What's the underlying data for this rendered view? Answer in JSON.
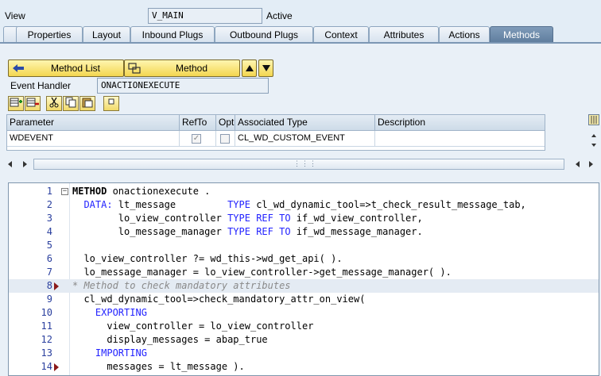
{
  "header": {
    "view_label": "View",
    "view_value": "V_MAIN",
    "status": "Active"
  },
  "tabs": [
    {
      "label": "Properties",
      "active": false
    },
    {
      "label": "Layout",
      "active": false
    },
    {
      "label": "Inbound Plugs",
      "active": false
    },
    {
      "label": "Outbound Plugs",
      "active": false
    },
    {
      "label": "Context",
      "active": false
    },
    {
      "label": "Attributes",
      "active": false
    },
    {
      "label": "Actions",
      "active": false
    },
    {
      "label": "Methods",
      "active": true
    }
  ],
  "method_toolbar": {
    "method_list_label": "Method List",
    "method_label": "Method"
  },
  "event_handler": {
    "label": "Event Handler",
    "value": "ONACTIONEXECUTE"
  },
  "param_table": {
    "columns": [
      "Parameter",
      "RefTo",
      "Opt",
      "Associated Type",
      "Description"
    ],
    "rows": [
      {
        "parameter": "WDEVENT",
        "refto": true,
        "opt": false,
        "associated_type": "CL_WD_CUSTOM_EVENT",
        "description": ""
      }
    ]
  },
  "editor": {
    "lines": [
      {
        "n": "1",
        "fold": true,
        "bp": false,
        "hl": false,
        "parts": [
          [
            "kw0",
            "METHOD"
          ],
          [
            "t",
            " onactionexecute ."
          ]
        ]
      },
      {
        "n": "2",
        "fold": false,
        "bp": false,
        "hl": false,
        "parts": [
          [
            "t",
            "  "
          ],
          [
            "kw",
            "DATA:"
          ],
          [
            "t",
            " lt_message         "
          ],
          [
            "kw",
            "TYPE"
          ],
          [
            "t",
            " cl_wd_dynamic_tool=>t_check_result_message_tab,"
          ]
        ]
      },
      {
        "n": "3",
        "fold": false,
        "bp": false,
        "hl": false,
        "parts": [
          [
            "t",
            "        lo_view_controller "
          ],
          [
            "kw",
            "TYPE REF TO"
          ],
          [
            "t",
            " if_wd_view_controller,"
          ]
        ]
      },
      {
        "n": "4",
        "fold": false,
        "bp": false,
        "hl": false,
        "parts": [
          [
            "t",
            "        lo_message_manager "
          ],
          [
            "kw",
            "TYPE REF TO"
          ],
          [
            "t",
            " if_wd_message_manager."
          ]
        ]
      },
      {
        "n": "5",
        "fold": false,
        "bp": false,
        "hl": false,
        "parts": [
          [
            "t",
            ""
          ]
        ]
      },
      {
        "n": "6",
        "fold": false,
        "bp": false,
        "hl": false,
        "parts": [
          [
            "t",
            "  lo_view_controller ?= wd_this->wd_get_api( )."
          ]
        ]
      },
      {
        "n": "7",
        "fold": false,
        "bp": false,
        "hl": false,
        "parts": [
          [
            "t",
            "  lo_message_manager = lo_view_controller->get_message_manager( )."
          ]
        ]
      },
      {
        "n": "8",
        "fold": false,
        "bp": true,
        "hl": true,
        "parts": [
          [
            "cm",
            "* Method to check mandatory attributes"
          ]
        ]
      },
      {
        "n": "9",
        "fold": false,
        "bp": false,
        "hl": false,
        "parts": [
          [
            "t",
            "  cl_wd_dynamic_tool=>check_mandatory_attr_on_view("
          ]
        ]
      },
      {
        "n": "10",
        "fold": false,
        "bp": false,
        "hl": false,
        "parts": [
          [
            "t",
            "    "
          ],
          [
            "kw",
            "EXPORTING"
          ]
        ]
      },
      {
        "n": "11",
        "fold": false,
        "bp": false,
        "hl": false,
        "parts": [
          [
            "t",
            "      view_controller = lo_view_controller"
          ]
        ]
      },
      {
        "n": "12",
        "fold": false,
        "bp": false,
        "hl": false,
        "parts": [
          [
            "t",
            "      display_messages = abap_true"
          ]
        ]
      },
      {
        "n": "13",
        "fold": false,
        "bp": false,
        "hl": false,
        "parts": [
          [
            "t",
            "    "
          ],
          [
            "kw",
            "IMPORTING"
          ]
        ]
      },
      {
        "n": "14",
        "fold": false,
        "bp": true,
        "hl": false,
        "parts": [
          [
            "t",
            "      messages = lt_message )."
          ]
        ]
      }
    ]
  }
}
